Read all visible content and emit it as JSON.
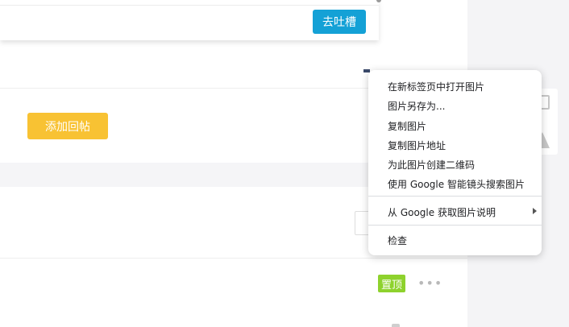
{
  "page": {
    "tucao_button": "去吐槽",
    "add_reply_button": "添加回帖",
    "pinned_badge": "置顶",
    "more_icon": "more-dots-icon"
  },
  "context_menu": {
    "items": [
      {
        "label": "在新标签页中打开图片"
      },
      {
        "label": "图片另存为..."
      },
      {
        "label": "复制图片"
      },
      {
        "label": "复制图片地址"
      },
      {
        "label": "为此图片创建二维码"
      },
      {
        "label": "使用 Google 智能镜头搜索图片"
      },
      {
        "label": "从 Google 获取图片说明",
        "has_submenu": true
      },
      {
        "label": "检查"
      }
    ]
  },
  "colors": {
    "tucao_button_bg": "#14a1d6",
    "add_reply_button_bg": "#f8c233",
    "pinned_badge_bg": "#8ed22d"
  }
}
